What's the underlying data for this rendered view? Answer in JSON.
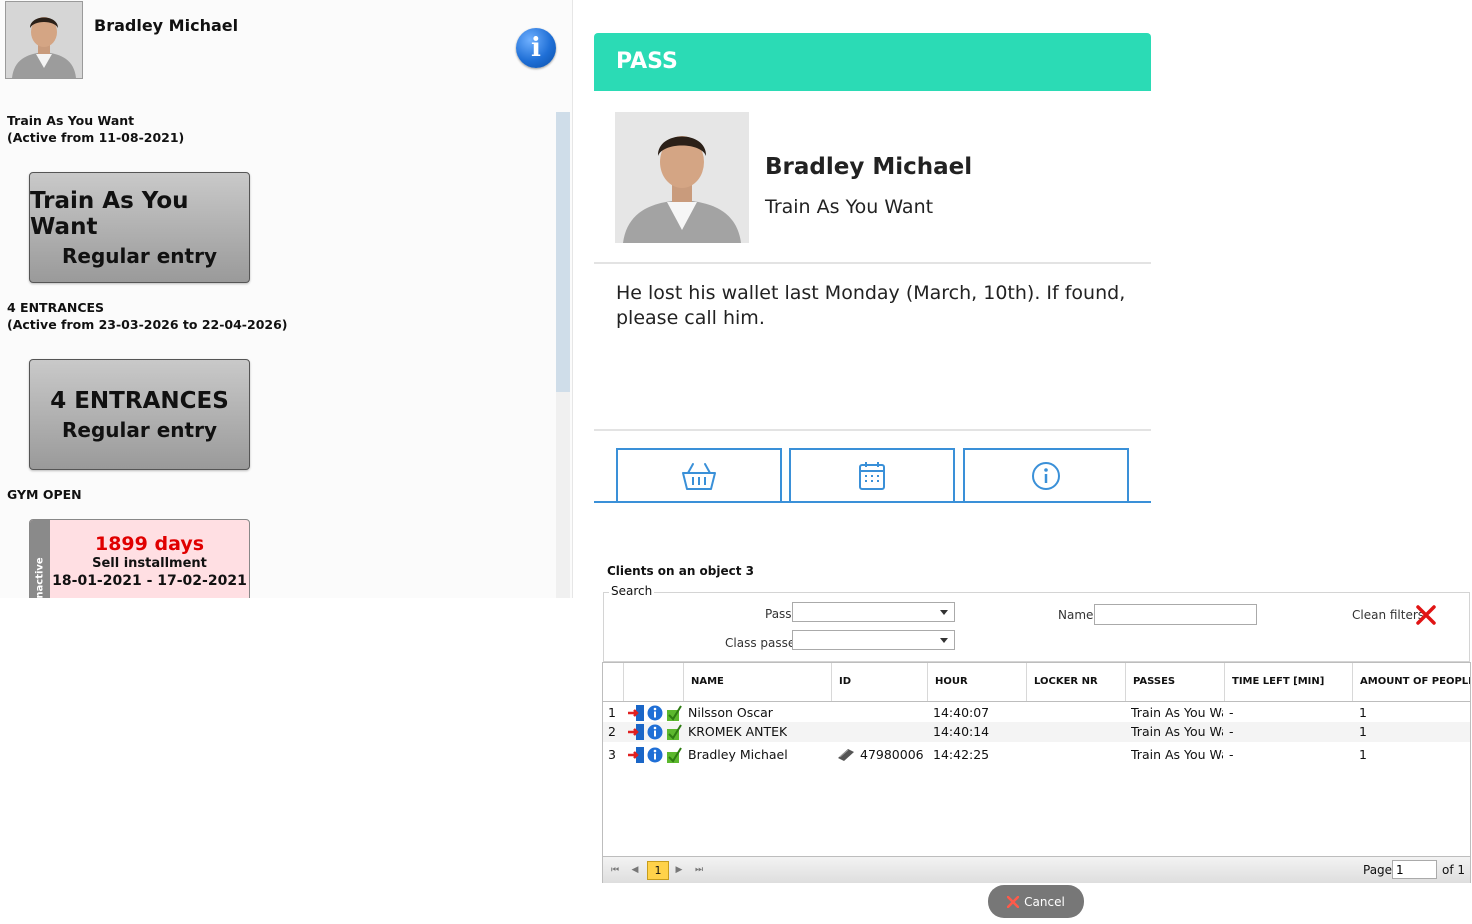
{
  "client": {
    "name": "Bradley Michael"
  },
  "passes": [
    {
      "label_line1": "Train As You Want",
      "label_line2": "(Active from 11-08-2021)",
      "button_title": "Train As You Want",
      "button_subtitle": "Regular entry"
    },
    {
      "label_line1": "4 ENTRANCES",
      "label_line2": "(Active from 23-03-2026 to 22-04-2026)",
      "button_title": "4 ENTRANCES",
      "button_subtitle": "Regular entry"
    }
  ],
  "gym_open": {
    "label": "GYM OPEN",
    "status": "Unactive",
    "days": "1899 days",
    "subtitle": "Sell installment",
    "dates": "18-01-2021 - 17-02-2021"
  },
  "pass_card": {
    "header": "PASS",
    "name": "Bradley Michael",
    "pass_name": "Train As You Want",
    "note": "He lost his wallet last Monday (March, 10th). If found, please call him."
  },
  "clients": {
    "title": "Clients on an object 3",
    "search": {
      "legend": "Search",
      "pass_label": "Pass",
      "class_passes_label": "Class passes",
      "name_label": "Name",
      "clean_filters": "Clean filters"
    },
    "columns": [
      "NAME",
      "ID",
      "HOUR",
      "LOCKER NR",
      "PASSES",
      "TIME LEFT [MIN]",
      "AMOUNT OF PEOPLE"
    ],
    "rows": [
      {
        "num": "1",
        "name": "Nilsson Oscar",
        "id": "",
        "hour": "14:40:07",
        "locker": "",
        "passes": "Train As You Wa",
        "time_left": "-",
        "people": "1"
      },
      {
        "num": "2",
        "name": "KROMEK ANTEK",
        "id": "",
        "hour": "14:40:14",
        "locker": "",
        "passes": "Train As You Wa",
        "time_left": "-",
        "people": "1"
      },
      {
        "num": "3",
        "name": "Bradley Michael",
        "id": "47980006",
        "hour": "14:42:25",
        "locker": "",
        "passes": "Train As You Wa",
        "time_left": "-",
        "people": "1"
      }
    ],
    "pager": {
      "current_page": "1",
      "page_label": "Page",
      "page_value": "1",
      "of_label": "of 1"
    },
    "cancel_label": "Cancel"
  }
}
